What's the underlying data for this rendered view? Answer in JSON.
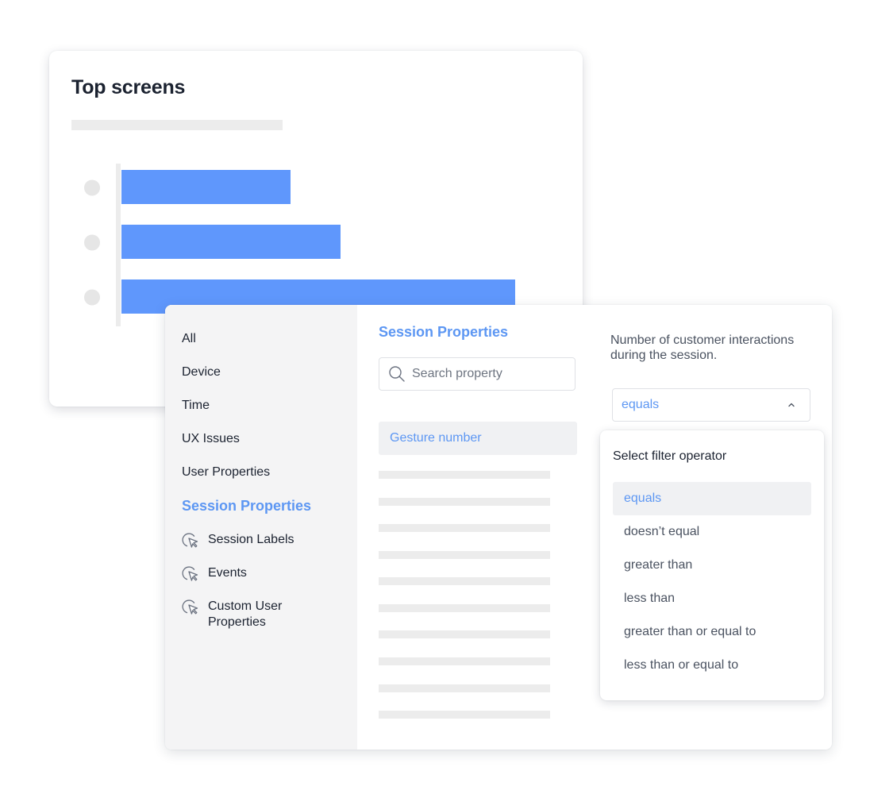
{
  "top_card": {
    "title": "Top screens"
  },
  "chart_data": {
    "type": "bar",
    "orientation": "horizontal",
    "categories": [
      "",
      "",
      ""
    ],
    "values": [
      213,
      276,
      496
    ],
    "xlim": [
      0,
      496
    ],
    "title": "Top screens",
    "grid": false,
    "bar_color": "#5f97fc"
  },
  "sidebar": {
    "items": [
      {
        "label": "All"
      },
      {
        "label": "Device"
      },
      {
        "label": "Time"
      },
      {
        "label": "UX Issues"
      },
      {
        "label": "User Properties"
      },
      {
        "label": "Session Properties",
        "active": true
      }
    ],
    "sub_items": [
      {
        "label": "Session Labels",
        "icon": "cursor-click-icon"
      },
      {
        "label": "Events",
        "icon": "cursor-click-icon"
      },
      {
        "label": "Custom User Properties",
        "icon": "cursor-click-icon"
      }
    ]
  },
  "properties": {
    "title": "Session Properties",
    "search_placeholder": "Search property",
    "search_icon": "search-icon",
    "selected_item": "Gesture number"
  },
  "detail": {
    "description": "Number of customer interactions during the session.",
    "operator_value": "equals",
    "chevron_icon": "chevron-up-icon",
    "dropdown": {
      "title": "Select filter operator",
      "options": [
        {
          "label": "equals",
          "selected": true
        },
        {
          "label": "doesn’t equal"
        },
        {
          "label": "greater than"
        },
        {
          "label": "less than"
        },
        {
          "label": "greater than or equal to"
        },
        {
          "label": "less than or equal to"
        }
      ]
    }
  },
  "colors": {
    "accent": "#5d97f3",
    "text": "#1b2230",
    "muted": "#4a5260"
  }
}
